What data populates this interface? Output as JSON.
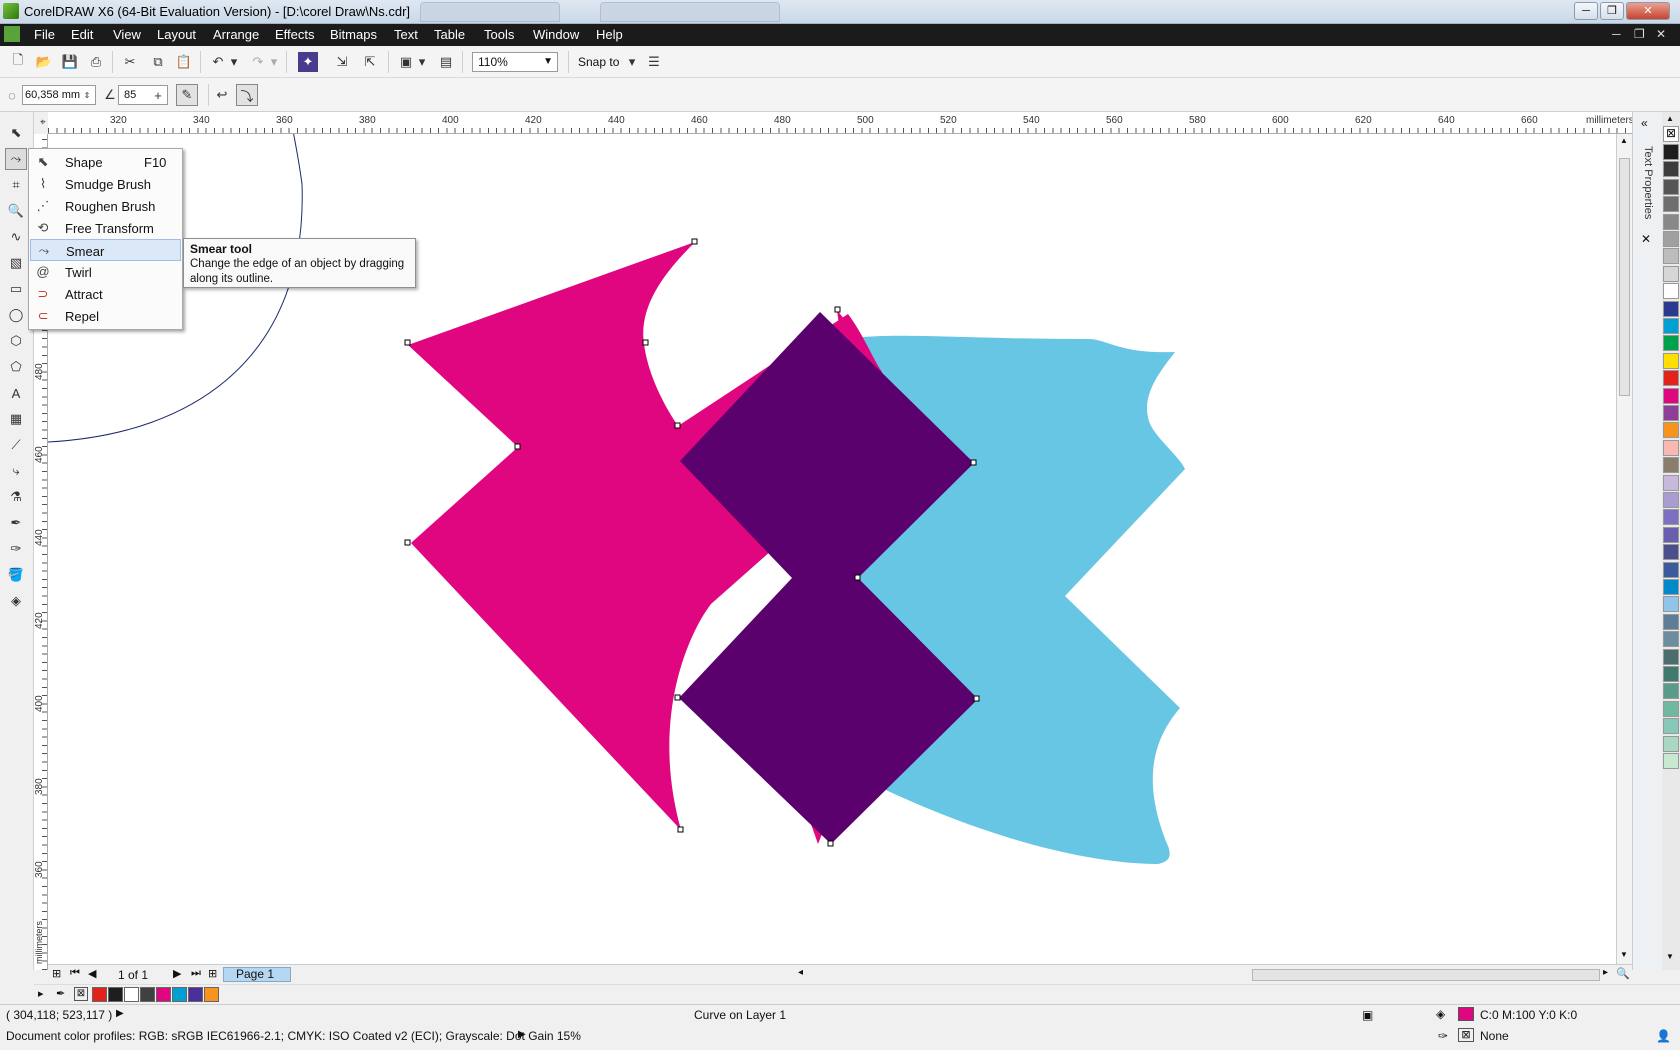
{
  "window": {
    "title": "CorelDRAW X6 (64-Bit Evaluation Version) - [D:\\corel Draw\\Ns.cdr]",
    "controls": [
      "─",
      "❐",
      "✕"
    ]
  },
  "menu": [
    "File",
    "Edit",
    "View",
    "Layout",
    "Arrange",
    "Effects",
    "Bitmaps",
    "Text",
    "Table",
    "Tools",
    "Window",
    "Help"
  ],
  "toolbar": {
    "zoom": "110%",
    "snap_to": "Snap to"
  },
  "property_bar": {
    "size_value": "60,358 mm",
    "pressure_value": "85"
  },
  "ruler": {
    "unit": "millimeters",
    "top_ticks": [
      "320",
      "340",
      "360",
      "380",
      "400",
      "420",
      "440",
      "460",
      "480",
      "500",
      "520",
      "540",
      "560",
      "580",
      "600",
      "620",
      "640",
      "660"
    ],
    "left_ticks": [
      "480",
      "460",
      "440",
      "420",
      "400",
      "380",
      "360"
    ]
  },
  "flyout": {
    "items": [
      {
        "label": "Shape",
        "shortcut": "F10",
        "icon": "shape-icon"
      },
      {
        "label": "Smudge Brush",
        "shortcut": "",
        "icon": "smudge-icon"
      },
      {
        "label": "Roughen Brush",
        "shortcut": "",
        "icon": "roughen-icon"
      },
      {
        "label": "Free Transform",
        "shortcut": "",
        "icon": "free-transform-icon"
      },
      {
        "label": "Smear",
        "shortcut": "",
        "icon": "smear-icon"
      },
      {
        "label": "Twirl",
        "shortcut": "",
        "icon": "twirl-icon"
      },
      {
        "label": "Attract",
        "shortcut": "",
        "icon": "attract-icon"
      },
      {
        "label": "Repel",
        "shortcut": "",
        "icon": "repel-icon"
      }
    ],
    "active_index": 4
  },
  "tooltip": {
    "title": "Smear tool",
    "body": "Change the edge of an object by dragging along its outline."
  },
  "docker": {
    "label": "Text Properties"
  },
  "page_nav": {
    "page_count": "1 of 1",
    "page_tab": "Page 1"
  },
  "status": {
    "coords": "( 304,118; 523,117 )",
    "object_info": "Curve on Layer 1",
    "fill_info": "C:0 M:100 Y:0 K:0",
    "outline_info": "None",
    "color_profiles": "Document color profiles: RGB: sRGB IEC61966-2.1; CMYK: ISO Coated v2 (ECI); Grayscale: Dot Gain 15%"
  },
  "colors": {
    "magenta": "#e0067f",
    "purple": "#5a016d",
    "cyan": "#67c6e4"
  },
  "palette_colors": [
    "#1e1e1e",
    "#3c3c3c",
    "#555",
    "#6e6e6e",
    "#888",
    "#a0a0a0",
    "#bdbdbd",
    "#d6d6d6",
    "#fff",
    "#2b3a8f",
    "#00a0d2",
    "#00a14b",
    "#ffde00",
    "#e2231a",
    "#e0067f",
    "#8e3e96",
    "#f7941d",
    "#f9b9b2",
    "#8b7d6b",
    "#c8b8dc",
    "#a89cd2",
    "#7d70c0",
    "#6a5fae",
    "#4c4f8c",
    "#3a5a9c",
    "#0089c8",
    "#90c4e8",
    "#5e7d98",
    "#6b8d9d",
    "#4d6d6d",
    "#3e7a6e",
    "#5a9a8a",
    "#70b8a0",
    "#88c8b8",
    "#a8d8c0",
    "#c8e8d0"
  ],
  "doc_palette": [
    "#e2231a",
    "#1e1e1e",
    "#fff",
    "#404040",
    "#e0067f",
    "#00a0d2",
    "#4b2f9a",
    "#f7941d"
  ]
}
